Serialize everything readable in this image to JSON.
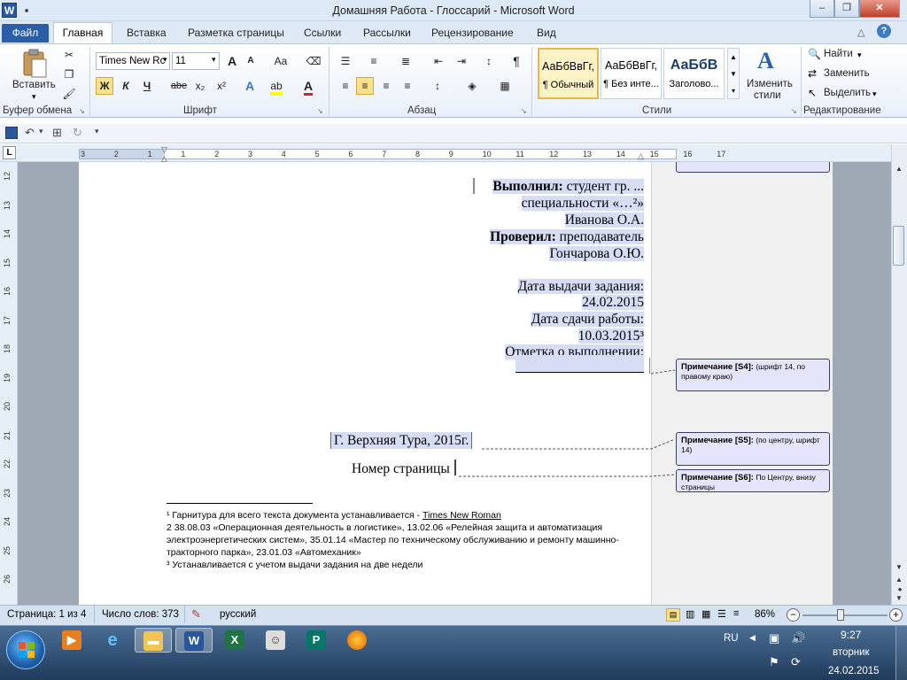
{
  "window": {
    "title": "Домашняя Работа - Глоссарий - Microsoft Word",
    "app_icon": "W",
    "minimize_icon": "–",
    "restore_icon": "❐",
    "close_icon": "✕"
  },
  "tabs": {
    "file": "Файл",
    "items": [
      "Главная",
      "Вставка",
      "Разметка страницы",
      "Ссылки",
      "Рассылки",
      "Рецензирование",
      "Вид"
    ]
  },
  "ribbon": {
    "clipboard": {
      "paste": "Вставить",
      "group": "Буфер обмена"
    },
    "font": {
      "name": "Times New Rc",
      "size": "11",
      "bold": "Ж",
      "italic": "К",
      "underline": "Ч",
      "strike": "abe",
      "sub": "x₂",
      "sup": "x²",
      "grow": "A",
      "shrink": "A",
      "case": "Aa",
      "group": "Шрифт"
    },
    "paragraph": {
      "group": "Абзац",
      "pilcrow": "¶"
    },
    "styles": {
      "items": [
        {
          "sample": "АаБбВвГг,",
          "name": "¶ Обычный"
        },
        {
          "sample": "АаБбВвГг,",
          "name": "¶ Без инте..."
        },
        {
          "sample": "АаБбВ",
          "name": "Заголово..."
        }
      ],
      "change_line1": "Изменить",
      "change_line2": "стили",
      "group": "Стили"
    },
    "editing": {
      "find": "Найти",
      "replace": "Заменить",
      "select": "Выделить",
      "group": "Редактирование"
    }
  },
  "ruler": {
    "h_ticks": [
      "3",
      "2",
      "1",
      "1",
      "2",
      "3",
      "4",
      "5",
      "6",
      "7",
      "8",
      "9",
      "10",
      "11",
      "12",
      "13",
      "14",
      "15",
      "16",
      "17"
    ],
    "v_ticks": [
      "12",
      "13",
      "14",
      "15",
      "16",
      "17",
      "18",
      "19",
      "20",
      "21",
      "22",
      "23",
      "24",
      "25",
      "26"
    ],
    "tab_marker": "L"
  },
  "document": {
    "lines": [
      {
        "bold": "Выполнил:",
        "text": "  студент гр.  ..."
      },
      {
        "bold": "",
        "text": "специальности «…²»"
      },
      {
        "bold": "",
        "text": "Иванова О.А."
      },
      {
        "bold": "Проверил:",
        "text": " преподаватель"
      },
      {
        "bold": "",
        "text": "Гончарова О.Ю."
      },
      {
        "bold": "",
        "text": "Дата выдачи задания:"
      },
      {
        "bold": "",
        "text": "24.02.2015"
      },
      {
        "bold": "",
        "text": "Дата сдачи работы:"
      },
      {
        "bold": "",
        "text": "10.03.2015³"
      },
      {
        "bold": "",
        "text": "Отметка о выполнении:"
      }
    ],
    "city": "Г. Верхняя Тура, 2015г.",
    "page_num": "Номер страницы",
    "footnotes": {
      "f1_prefix": "¹ Гарнитура для всего текста документа устанавливается - ",
      "f1_font": "Times New Roman",
      "f2_line1": "2  38.08.03   «Операционная деятельность в логистике»,   13.02.06 «Релейная защита и автоматизация",
      "f2_line2": "электроэнергетических систем», 35.01.14 «Мастер по техническому обслуживанию и ремонту машинно-",
      "f2_line3": "тракторного парка»,  23.01.03 «Автомеханик»",
      "f3": "³ Устанавливается с учетом выдачи задания на две недели"
    }
  },
  "comments": {
    "s4": {
      "label": "Примечание [S4]:",
      "text": " (шрифт 14, по правому краю)"
    },
    "s5": {
      "label": "Примечание [S5]:",
      "text": " (по центру, шрифт 14)"
    },
    "s6": {
      "label": "Примечание [S6]:",
      "text": " По Центру, внизу страницы"
    }
  },
  "status": {
    "page": "Страница: 1 из 4",
    "words": "Число слов: 373",
    "lang": "русский",
    "zoom": "86%"
  },
  "taskbar": {
    "lang": "RU",
    "time": "9:27",
    "day": "вторник",
    "date": "24.02.2015"
  },
  "colors": {
    "accent": "#2a5ea8",
    "comment_bg": "#e4e4fa",
    "highlight": "#d7ddf5"
  }
}
